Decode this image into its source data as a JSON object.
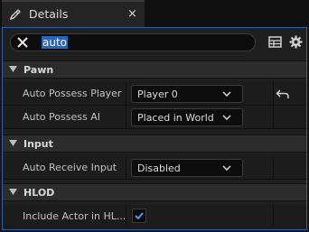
{
  "tab": {
    "title": "Details",
    "close_glyph": "×",
    "icon": "pencil-icon"
  },
  "search": {
    "value": "auto"
  },
  "toolbar": {
    "icons": [
      "table-view-icon",
      "settings-gear-icon"
    ]
  },
  "categories": [
    {
      "label": "Pawn",
      "properties": [
        {
          "label": "Auto Possess Player",
          "value": "Player 0",
          "reset": true
        },
        {
          "label": "Auto Possess AI",
          "value": "Placed in World"
        }
      ]
    },
    {
      "label": "Input",
      "properties": [
        {
          "label": "Auto Receive Input",
          "value": "Disabled"
        }
      ]
    },
    {
      "label": "HLOD",
      "properties": [
        {
          "label": "Include Actor in HL...",
          "checked": true
        }
      ]
    }
  ],
  "colors": {
    "accent": "#2565c2",
    "checkmark": "#4d9be6",
    "panel_border": "#2f5fa3"
  }
}
